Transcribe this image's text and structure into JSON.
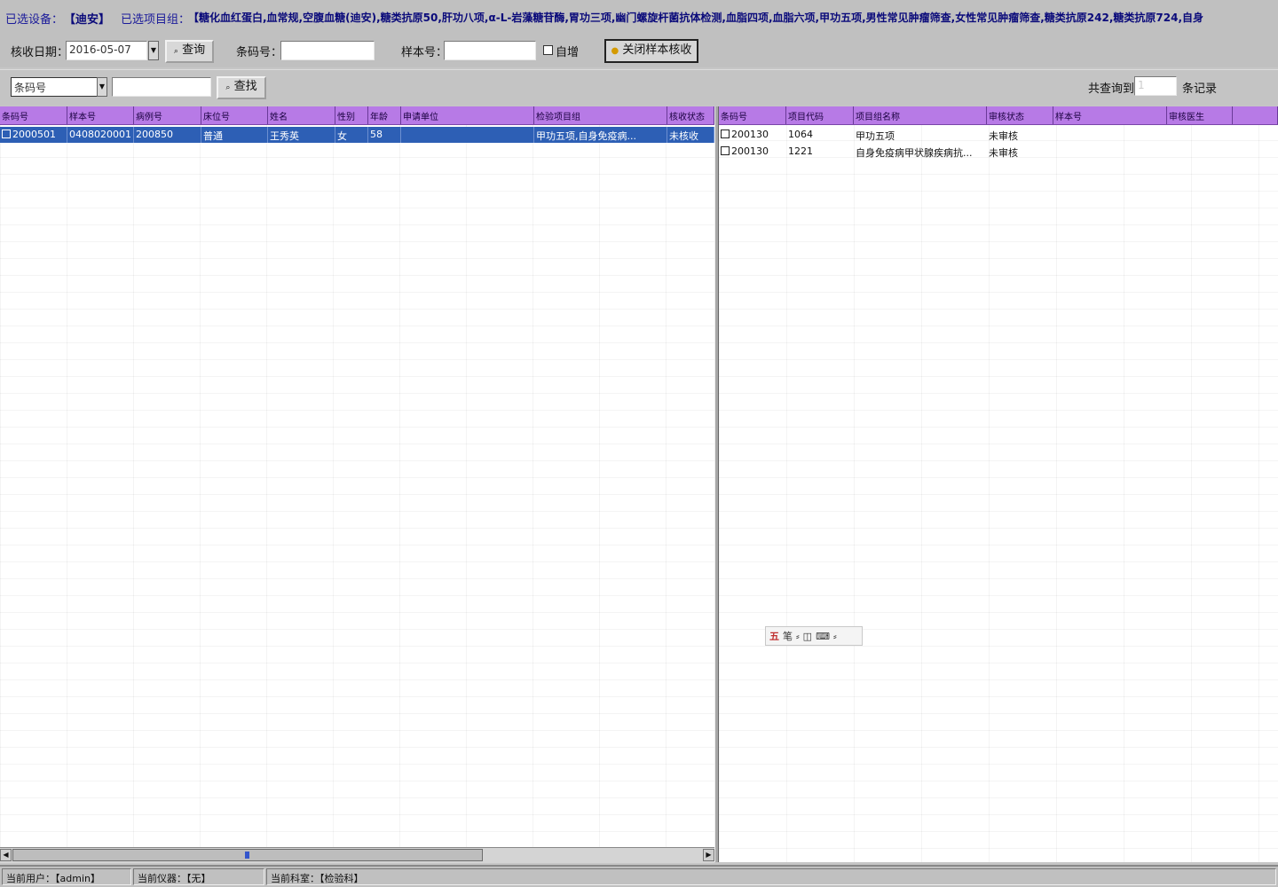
{
  "info_bar": {
    "device_label": "已选设备：",
    "device_value": "【迪安】",
    "items_label": "已选项目组：",
    "items_value": "【糖化血红蛋白,血常规,空腹血糖(迪安),糖类抗原50,肝功八项,α-L-岩藻糖苷酶,胃功三项,幽门螺旋杆菌抗体检测,血脂四项,血脂六项,甲功五项,男性常见肿瘤筛查,女性常见肿瘤筛查,糖类抗原242,糖类抗原724,自身"
  },
  "toolbar": {
    "check_date_label": "核收日期：",
    "check_date_value": "2016-05-07",
    "query_button": "查询",
    "barcode_label": "条码号：",
    "barcode_value": "",
    "sample_label": "样本号：",
    "sample_value": "",
    "auto_add_label": "自增",
    "close_button": "关闭样本核收"
  },
  "search_bar": {
    "field_select": "条码号",
    "search_value": "",
    "search_button": "查找",
    "total_label": "共查询到",
    "total_value": "1",
    "records_label": "条记录"
  },
  "left_grid": {
    "columns": [
      "条码号",
      "样本号",
      "病例号",
      "床位号",
      "姓名",
      "性别",
      "年龄",
      "申请单位",
      "检验项目组",
      "核收状态"
    ],
    "rows": [
      [
        "2000501",
        "0408020001",
        "200850",
        "普通",
        "王秀英",
        "女",
        "58",
        "",
        "甲功五项,自身免疫病...",
        "未核收"
      ]
    ]
  },
  "right_grid": {
    "columns": [
      "条码号",
      "项目代码",
      "项目组名称",
      "审核状态",
      "样本号",
      "审核医生"
    ],
    "rows": [
      [
        "200130",
        "1064",
        "甲功五项",
        "未审核",
        "",
        ""
      ],
      [
        "200130",
        "1221",
        "自身免疫病甲状腺疾病抗...",
        "未审核",
        "",
        ""
      ]
    ]
  },
  "ime_toolbar": {
    "items": [
      "五",
      "笔",
      "⸗",
      "◫",
      "⌨",
      "⸗"
    ]
  },
  "status_bar": {
    "user": "当前用户：【admin】",
    "device": "当前仪器：【无】",
    "department": "当前科室：【检验科】"
  }
}
